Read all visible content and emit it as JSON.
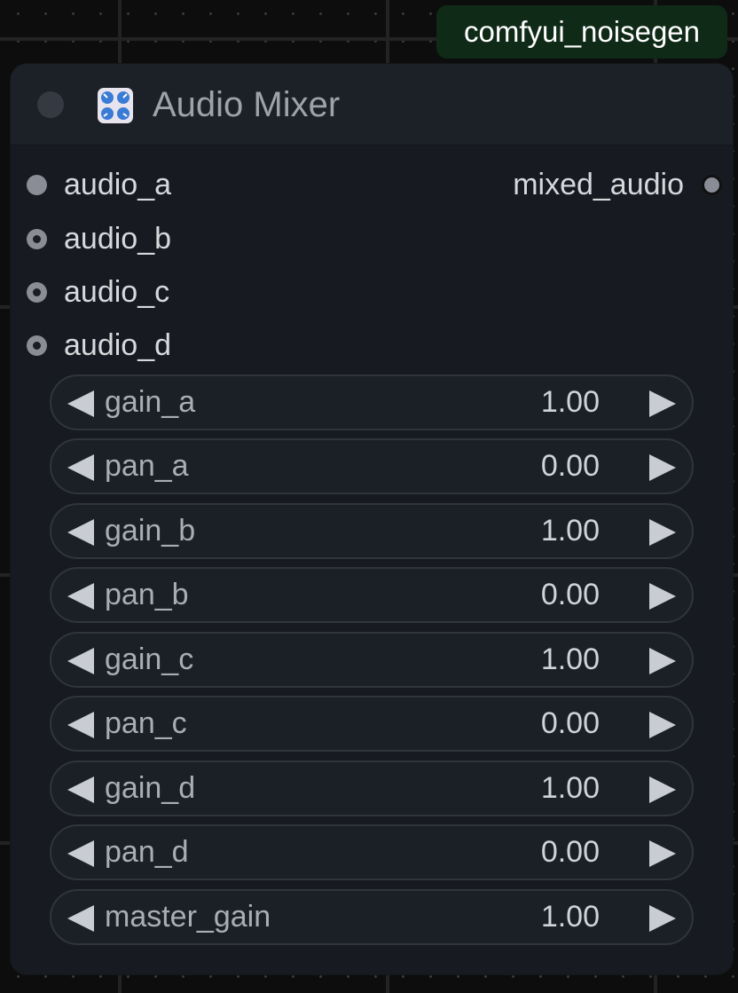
{
  "badge": {
    "text": "comfyui_noisegen"
  },
  "node": {
    "title": "Audio Mixer",
    "icon": "mixer-knobs-icon",
    "inputs": [
      {
        "label": "audio_a",
        "connected": false
      },
      {
        "label": "audio_b",
        "connected": true
      },
      {
        "label": "audio_c",
        "connected": true
      },
      {
        "label": "audio_d",
        "connected": true
      }
    ],
    "outputs": [
      {
        "label": "mixed_audio"
      }
    ],
    "widgets": [
      {
        "name": "gain_a",
        "value": "1.00"
      },
      {
        "name": "pan_a",
        "value": "0.00"
      },
      {
        "name": "gain_b",
        "value": "1.00"
      },
      {
        "name": "pan_b",
        "value": "0.00"
      },
      {
        "name": "gain_c",
        "value": "1.00"
      },
      {
        "name": "pan_c",
        "value": "0.00"
      },
      {
        "name": "gain_d",
        "value": "1.00"
      },
      {
        "name": "pan_d",
        "value": "0.00"
      },
      {
        "name": "master_gain",
        "value": "1.00"
      }
    ]
  },
  "colors": {
    "badge_bg": "#0f2a17",
    "node_bg": "#171a20",
    "slot_dot": "#8a8d96"
  }
}
